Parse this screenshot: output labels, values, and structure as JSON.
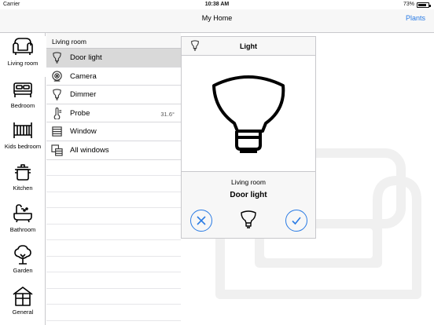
{
  "status_bar": {
    "carrier": "Carrier",
    "time": "10:38 AM",
    "battery": "73%"
  },
  "nav": {
    "title": "My Home",
    "right_button": "Plants"
  },
  "rooms": [
    {
      "label": "Living room",
      "icon": "sofa-icon"
    },
    {
      "label": "Bedroom",
      "icon": "bed-icon"
    },
    {
      "label": "Kids bedroom",
      "icon": "crib-icon"
    },
    {
      "label": "Kitchen",
      "icon": "pot-icon"
    },
    {
      "label": "Bathroom",
      "icon": "bathtub-icon"
    },
    {
      "label": "Garden",
      "icon": "tree-icon"
    },
    {
      "label": "General",
      "icon": "house-icon"
    }
  ],
  "devices": {
    "section_title": "Living room",
    "items": [
      {
        "name": "Door light",
        "icon": "bulb-icon"
      },
      {
        "name": "Camera",
        "icon": "camera-icon"
      },
      {
        "name": "Dimmer",
        "icon": "bulb-icon"
      },
      {
        "name": "Probe",
        "icon": "thermometer-icon",
        "value": "31.6°"
      },
      {
        "name": "Window",
        "icon": "window-icon"
      },
      {
        "name": "All windows",
        "icon": "windows-icon"
      }
    ]
  },
  "detail": {
    "title": "Light",
    "room": "Living room",
    "device": "Door light"
  },
  "colors": {
    "accent": "#2a7be4",
    "selected_row": "#d9d9d9",
    "separator": "#c8c8cc",
    "watermark": "#f0f0f0"
  }
}
